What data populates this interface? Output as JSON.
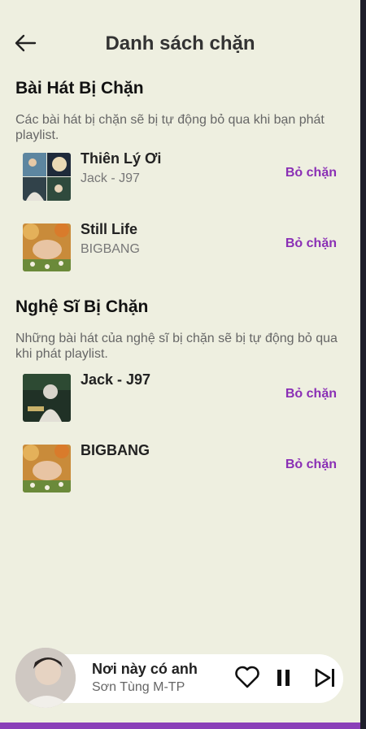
{
  "header": {
    "title": "Danh sách chặn"
  },
  "blocked_songs": {
    "title": "Bài Hát Bị Chặn",
    "description": "Các bài hát bị chặn sẽ bị tự động bỏ qua khi bạn phát playlist.",
    "items": [
      {
        "name": "Thiên Lý Ơi",
        "artist": "Jack - J97",
        "action": "Bỏ chặn"
      },
      {
        "name": "Still Life",
        "artist": "BIGBANG",
        "action": "Bỏ chặn"
      }
    ]
  },
  "blocked_artists": {
    "title": "Nghệ Sĩ Bị Chặn",
    "description": "Những bài hát của nghệ sĩ bị chặn sẽ bị tự động bỏ qua khi phát playlist.",
    "items": [
      {
        "name": "Jack - J97",
        "action": "Bỏ chặn"
      },
      {
        "name": "BIGBANG",
        "action": "Bỏ chặn"
      }
    ]
  },
  "player": {
    "title": "Nơi này có anh",
    "artist": "Sơn Tùng M-TP",
    "icons": [
      "heart-icon",
      "pause-icon",
      "skip-next-icon"
    ]
  },
  "colors": {
    "background": "#eeefe0",
    "accent": "#8a2fb5"
  }
}
